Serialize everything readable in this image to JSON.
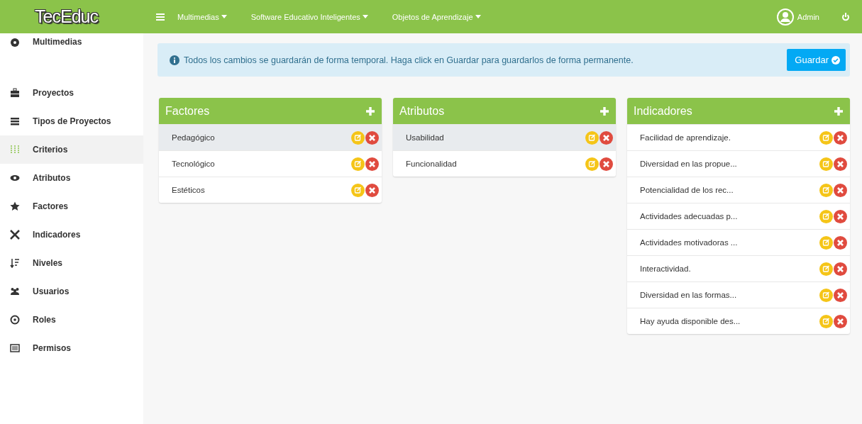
{
  "brand": "TecEduc",
  "nav": [
    {
      "label": "Multimedias"
    },
    {
      "label": "Software Educativo Inteligentes"
    },
    {
      "label": "Objetos de Aprendizaje"
    }
  ],
  "user": {
    "name": "Admin"
  },
  "sidebar": {
    "items": [
      {
        "label": "Multimedias",
        "selected": false
      },
      {
        "label": "Proyectos",
        "selected": false
      },
      {
        "label": "Tipos de Proyectos",
        "selected": false
      },
      {
        "label": "Criterios",
        "selected": true
      },
      {
        "label": "Atributos",
        "selected": false
      },
      {
        "label": "Factores",
        "selected": false
      },
      {
        "label": "Indicadores",
        "selected": false
      },
      {
        "label": "Niveles",
        "selected": false
      },
      {
        "label": "Usuarios",
        "selected": false
      },
      {
        "label": "Roles",
        "selected": false
      },
      {
        "label": "Permisos",
        "selected": false
      }
    ]
  },
  "alert": {
    "text": "Todos los cambios se guardarán de forma temporal. Haga click en Guardar para guardarlos de forma permanente.",
    "button": "Guardar"
  },
  "panels": [
    {
      "title": "Factores",
      "rows": [
        {
          "label": "Pedagógico",
          "selected": true
        },
        {
          "label": "Tecnológico",
          "selected": false
        },
        {
          "label": "Estéticos",
          "selected": false
        }
      ]
    },
    {
      "title": "Atributos",
      "rows": [
        {
          "label": "Usabilidad",
          "selected": true
        },
        {
          "label": "Funcionalidad",
          "selected": false
        }
      ]
    },
    {
      "title": "Indicadores",
      "rows": [
        {
          "label": "Facilidad de aprendizaje.",
          "selected": false
        },
        {
          "label": "Diversidad en las propue...",
          "selected": false
        },
        {
          "label": "Potencialidad de los rec...",
          "selected": false
        },
        {
          "label": "Actividades adecuadas p...",
          "selected": false
        },
        {
          "label": "Actividades motivadoras ...",
          "selected": false
        },
        {
          "label": "Interactividad.",
          "selected": false
        },
        {
          "label": "Diversidad en las formas...",
          "selected": false
        },
        {
          "label": "Hay ayuda disponible des...",
          "selected": false
        }
      ]
    }
  ]
}
